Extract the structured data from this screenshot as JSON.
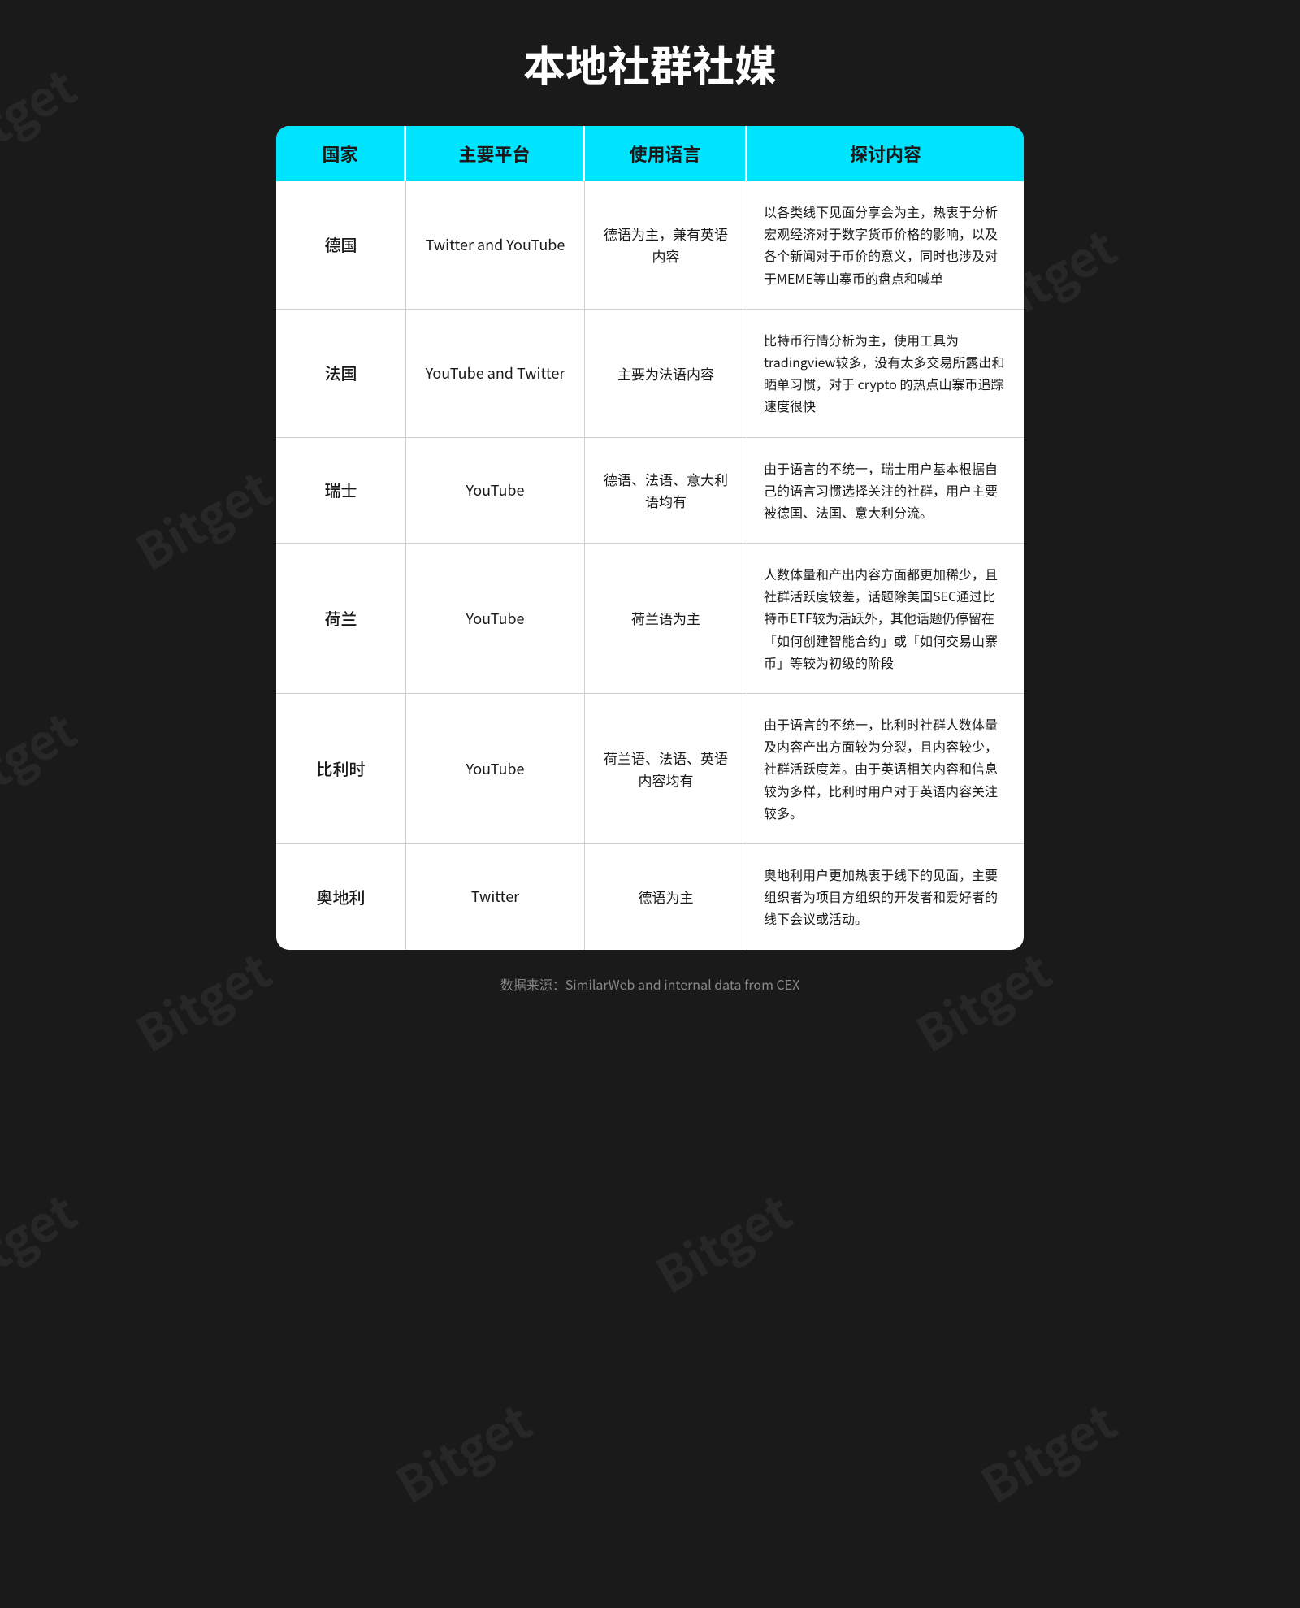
{
  "page": {
    "title": "本地社群社媒",
    "footer": "数据来源：SimilarWeb and internal data from CEX"
  },
  "table": {
    "headers": {
      "country": "国家",
      "platform": "主要平台",
      "language": "使用语言",
      "content": "探讨内容"
    },
    "rows": [
      {
        "country": "德国",
        "platform": "Twitter and YouTube",
        "language": "德语为主，兼有英语内容",
        "content": "以各类线下见面分享会为主，热衷于分析宏观经济对于数字货币价格的影响，以及各个新闻对于币价的意义，同时也涉及对于MEME等山寨币的盘点和喊单"
      },
      {
        "country": "法国",
        "platform": "YouTube and Twitter",
        "language": "主要为法语内容",
        "content": "比特币行情分析为主，使用工具为tradingview较多，没有太多交易所露出和晒单习惯，对于 crypto 的热点山寨币追踪速度很快"
      },
      {
        "country": "瑞士",
        "platform": "YouTube",
        "language": "德语、法语、意大利语均有",
        "content": "由于语言的不统一，瑞士用户基本根据自己的语言习惯选择关注的社群，用户主要被德国、法国、意大利分流。"
      },
      {
        "country": "荷兰",
        "platform": "YouTube",
        "language": "荷兰语为主",
        "content": "人数体量和产出内容方面都更加稀少，且社群活跃度较差，话题除美国SEC通过比特币ETF较为活跃外，其他话题仍停留在「如何创建智能合约」或「如何交易山寨币」等较为初级的阶段"
      },
      {
        "country": "比利时",
        "platform": "YouTube",
        "language": "荷兰语、法语、英语内容均有",
        "content": "由于语言的不统一，比利时社群人数体量及内容产出方面较为分裂，且内容较少，社群活跃度差。由于英语相关内容和信息较为多样，比利时用户对于英语内容关注较多。"
      },
      {
        "country": "奥地利",
        "platform": "Twitter",
        "language": "德语为主",
        "content": "奥地利用户更加热衷于线下的见面，主要组织者为项目方组织的开发者和爱好者的线下会议或活动。"
      }
    ]
  },
  "watermarks": [
    "Bitget",
    "Bitget",
    "Bitget",
    "Bitget",
    "Bitget",
    "Bitget",
    "Bitget",
    "Bitget",
    "Bitget",
    "Bitget",
    "Bitget",
    "Bitget"
  ]
}
